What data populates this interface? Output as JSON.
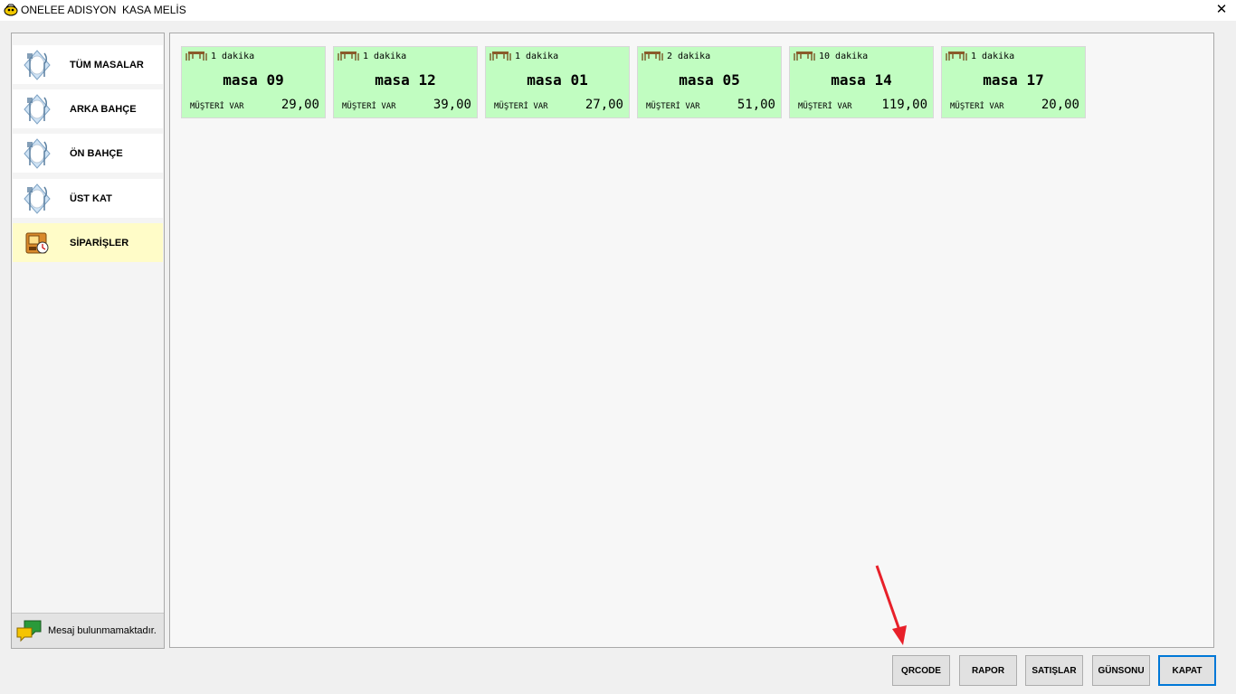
{
  "window": {
    "title": "ONELEE ADISYON  KASA MELİS",
    "close_glyph": "✕"
  },
  "sidebar": {
    "items": [
      {
        "label": "TÜM MASALAR",
        "icon": "cutlery-icon",
        "active": false
      },
      {
        "label": "ARKA BAHÇE",
        "icon": "cutlery-icon",
        "active": false
      },
      {
        "label": "ÖN BAHÇE",
        "icon": "cutlery-icon",
        "active": false
      },
      {
        "label": "ÜST KAT",
        "icon": "cutlery-icon",
        "active": false
      },
      {
        "label": "SİPARİŞLER",
        "icon": "orders-icon",
        "active": true
      }
    ],
    "message": "Mesaj bulunmamaktadır."
  },
  "tables": [
    {
      "time": "1 dakika",
      "name": "masa 09",
      "status": "MÜŞTERİ VAR",
      "amount": "29,00"
    },
    {
      "time": "1 dakika",
      "name": "masa 12",
      "status": "MÜŞTERİ VAR",
      "amount": "39,00"
    },
    {
      "time": "1 dakika",
      "name": "masa 01",
      "status": "MÜŞTERİ VAR",
      "amount": "27,00"
    },
    {
      "time": "2 dakika",
      "name": "masa 05",
      "status": "MÜŞTERİ VAR",
      "amount": "51,00"
    },
    {
      "time": "10 dakika",
      "name": "masa 14",
      "status": "MÜŞTERİ VAR",
      "amount": "119,00"
    },
    {
      "time": "1 dakika",
      "name": "masa 17",
      "status": "MÜŞTERİ VAR",
      "amount": "20,00"
    }
  ],
  "colors": {
    "card_background": "#c1fdc1",
    "active_sidebar": "#fffcc8",
    "annotation_arrow": "#e8202a",
    "primary_button_border": "#0078d7"
  },
  "toolbar": {
    "qrcode": "QRCODE",
    "rapor": "RAPOR",
    "satislar": "SATIŞLAR",
    "gunsonu": "GÜNSONU",
    "kapat": "KAPAT"
  }
}
